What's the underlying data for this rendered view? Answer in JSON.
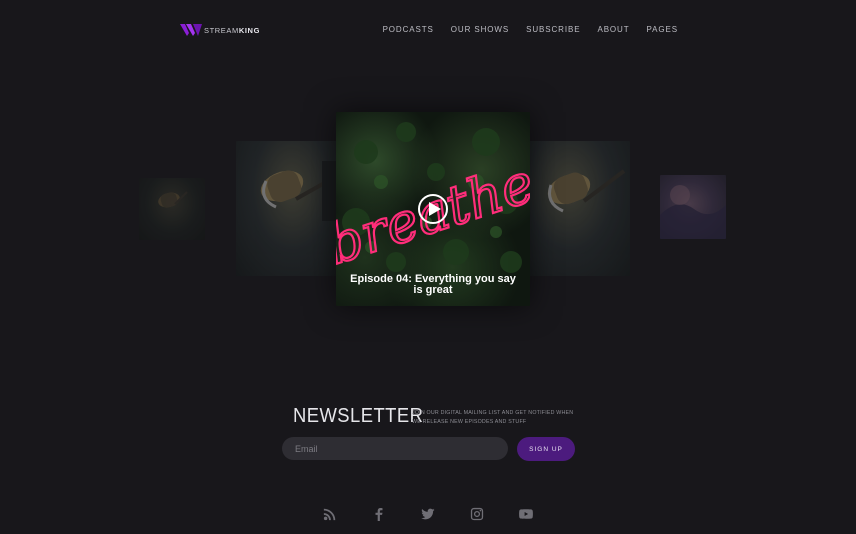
{
  "brand": {
    "name_light": "STREAM",
    "name_bold": "KING",
    "accent": "#8b1ed6"
  },
  "nav": {
    "items": [
      "PODCASTS",
      "OUR SHOWS",
      "SUBSCRIBE",
      "ABOUT",
      "PAGES"
    ]
  },
  "carousel": {
    "active": {
      "title": "Episode 04: Everything you say is great",
      "neon_text": "breathe"
    },
    "neon_color": "#ff2d7a"
  },
  "newsletter": {
    "title": "NEWSLETTER",
    "description": "JOIN OUR DIGITAL MAILING LIST AND GET NOTIFIED WHEN WE RELEASE NEW EPISODES AND STUFF",
    "email_placeholder": "Email",
    "button_label": "SIGN UP",
    "button_color": "#4c1b7e"
  },
  "social": {
    "icons": [
      "rss-icon",
      "facebook-icon",
      "twitter-icon",
      "instagram-icon",
      "youtube-icon"
    ]
  }
}
